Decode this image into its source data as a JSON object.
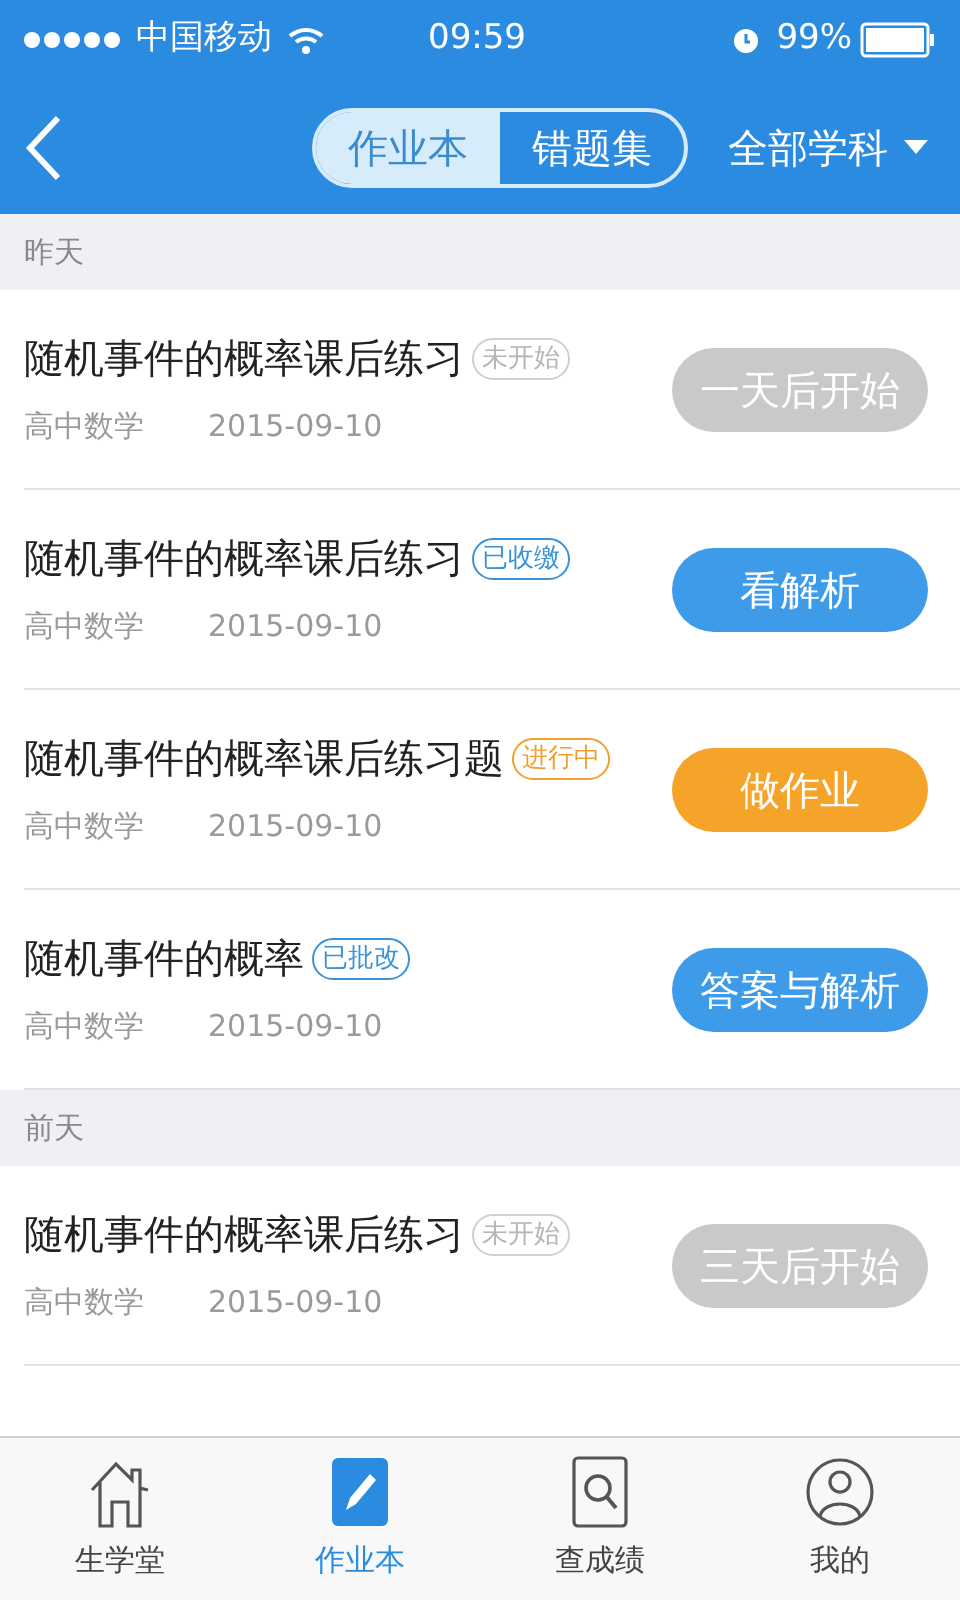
{
  "status_bar": {
    "carrier": "中国移动",
    "time": "09:59",
    "battery": "99%"
  },
  "nav": {
    "tabs": [
      {
        "label": "作业本",
        "selected": true
      },
      {
        "label": "错题集",
        "selected": false
      }
    ],
    "filter": "全部学科"
  },
  "sections": [
    {
      "title": "昨天",
      "items": [
        {
          "title": "随机事件的概率课后练习",
          "status": "未开始",
          "kind": "pending",
          "subject": "高中数学",
          "date": "2015-09-10",
          "action": "一天后开始"
        },
        {
          "title": "随机事件的概率课后练习",
          "status": "已收缴",
          "kind": "collected",
          "subject": "高中数学",
          "date": "2015-09-10",
          "action": "看解析"
        },
        {
          "title": "随机事件的概率课后练习题",
          "status": "进行中",
          "kind": "active",
          "subject": "高中数学",
          "date": "2015-09-10",
          "action": "做作业"
        },
        {
          "title": "随机事件的概率",
          "status": "已批改",
          "kind": "graded",
          "subject": "高中数学",
          "date": "2015-09-10",
          "action": "答案与解析"
        }
      ]
    },
    {
      "title": "前天",
      "items": [
        {
          "title": "随机事件的概率课后练习",
          "status": "未开始",
          "kind": "pending",
          "subject": "高中数学",
          "date": "2015-09-10",
          "action": "三天后开始"
        }
      ]
    }
  ],
  "tab_bar": [
    {
      "label": "生学堂",
      "kind": "home",
      "selected": false
    },
    {
      "label": "作业本",
      "kind": "homework",
      "selected": true
    },
    {
      "label": "查成绩",
      "kind": "scores",
      "selected": false
    },
    {
      "label": "我的",
      "kind": "profile",
      "selected": false
    }
  ]
}
